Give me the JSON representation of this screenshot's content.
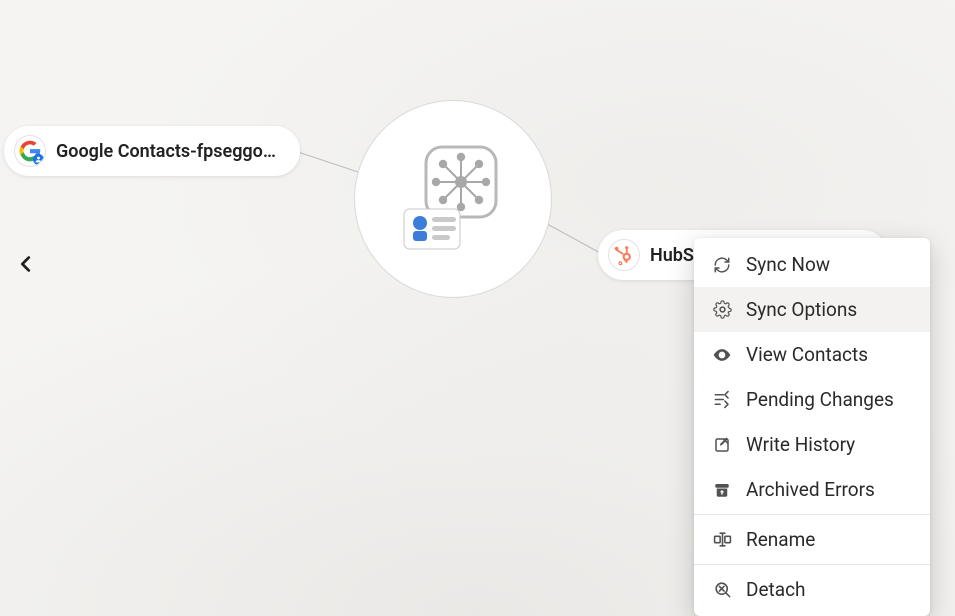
{
  "nodes": {
    "left": {
      "label": "Google Contacts-fpseggo…",
      "icon_name": "google-contacts-icon"
    },
    "right": {
      "label": "HubS",
      "icon_name": "hubspot-icon"
    }
  },
  "hub": {
    "icon_name": "hub-contacts-icon"
  },
  "nav": {
    "back_icon": "chevron-left-icon"
  },
  "menu": {
    "groups": [
      [
        {
          "id": "sync-now",
          "label": "Sync Now",
          "icon": "sync-icon",
          "hovered": false
        },
        {
          "id": "sync-options",
          "label": "Sync Options",
          "icon": "gear-icon",
          "hovered": true
        },
        {
          "id": "view-contacts",
          "label": "View Contacts",
          "icon": "eye-icon",
          "hovered": false
        },
        {
          "id": "pending-changes",
          "label": "Pending Changes",
          "icon": "pending-icon",
          "hovered": false
        },
        {
          "id": "write-history",
          "label": "Write History",
          "icon": "write-history-icon",
          "hovered": false
        },
        {
          "id": "archived-errors",
          "label": "Archived Errors",
          "icon": "archive-icon",
          "hovered": false
        }
      ],
      [
        {
          "id": "rename",
          "label": "Rename",
          "icon": "rename-icon",
          "hovered": false
        }
      ],
      [
        {
          "id": "detach",
          "label": "Detach",
          "icon": "detach-icon",
          "hovered": false
        }
      ]
    ]
  }
}
